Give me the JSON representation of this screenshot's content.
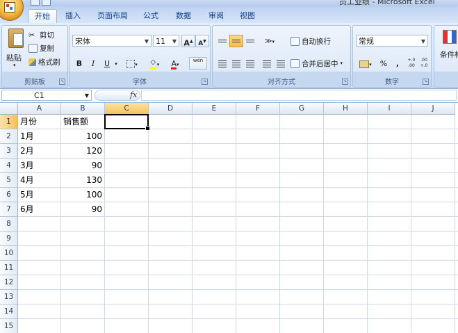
{
  "window": {
    "title": "员工业绩 - Microsoft Excel"
  },
  "tabs": [
    {
      "label": "开始",
      "active": true
    },
    {
      "label": "插入"
    },
    {
      "label": "页面布局"
    },
    {
      "label": "公式"
    },
    {
      "label": "数据"
    },
    {
      "label": "审阅"
    },
    {
      "label": "视图"
    }
  ],
  "ribbon": {
    "clipboard": {
      "label": "剪贴板",
      "paste": "粘贴",
      "cut": "剪切",
      "copy": "复制",
      "format_painter": "格式刷"
    },
    "font": {
      "label": "字体",
      "name": "宋体",
      "size": "11",
      "bold": "B",
      "italic": "I",
      "underline": "U",
      "font_color_glyph": "A",
      "grow": "A",
      "shrink": "A",
      "wen": "wén"
    },
    "alignment": {
      "label": "对齐方式",
      "wrap_text": "自动换行",
      "merge_center": "合并后居中"
    },
    "number": {
      "label": "数字",
      "format": "常规",
      "percent": "%",
      "comma": ",",
      "increase_decimal": "+.0 .00",
      "decrease_decimal": ".00 +.0"
    },
    "styles": {
      "conditional_format": "条件格"
    }
  },
  "formula_bar": {
    "name_box": "C1",
    "fx": "fx",
    "content": ""
  },
  "grid": {
    "columns": [
      "A",
      "B",
      "C",
      "D",
      "E",
      "F",
      "G",
      "H",
      "I",
      "J"
    ],
    "rows": [
      "1",
      "2",
      "3",
      "4",
      "5",
      "6",
      "7",
      "8",
      "9",
      "10",
      "11",
      "12",
      "13",
      "14",
      "15"
    ],
    "selected_cell": "C1",
    "cells": {
      "A1": "月份",
      "B1": "销售额",
      "A2": "1月",
      "B2": "100",
      "A3": "2月",
      "B3": "120",
      "A4": "3月",
      "B4": "90",
      "A5": "4月",
      "B5": "130",
      "A6": "5月",
      "B6": "100",
      "A7": "6月",
      "B7": "90"
    }
  }
}
